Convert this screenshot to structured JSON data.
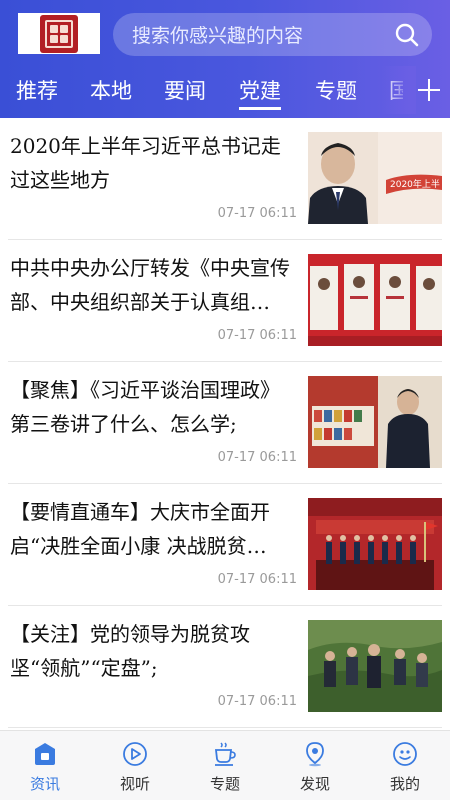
{
  "search": {
    "placeholder": "搜索你感兴趣的内容"
  },
  "tabs": [
    {
      "label": "推荐"
    },
    {
      "label": "本地"
    },
    {
      "label": "要闻"
    },
    {
      "label": "党建"
    },
    {
      "label": "专题"
    },
    {
      "label": "国"
    }
  ],
  "active_tab": "党建",
  "news": [
    {
      "title": "2020年上半年习近平总书记走过这些地方",
      "time": "07-17 06:11",
      "image_text": "2020年上半"
    },
    {
      "title": "中共中央办公厅转发《中央宣传部、中央组织部关于认真组…",
      "time": "07-17 06:11",
      "image_text": ""
    },
    {
      "title": "【聚焦】《习近平谈治国理政》第三卷讲了什么、怎么学;",
      "time": "07-17 06:11",
      "image_text": ""
    },
    {
      "title": "【要情直通车】大庆市全面开启“决胜全面小康 决战脱贫…",
      "time": "07-17 06:11",
      "image_text": ""
    },
    {
      "title": "【关注】党的领导为脱贫攻坚“领航”“定盘”;",
      "time": "07-17 06:11",
      "image_text": ""
    }
  ],
  "bottom_nav": [
    {
      "label": "资讯",
      "icon": "news-icon",
      "active": true
    },
    {
      "label": "视听",
      "icon": "play-icon",
      "active": false
    },
    {
      "label": "专题",
      "icon": "cup-icon",
      "active": false
    },
    {
      "label": "发现",
      "icon": "location-icon",
      "active": false
    },
    {
      "label": "我的",
      "icon": "profile-icon",
      "active": false
    }
  ],
  "colors": {
    "header_start": "#3a4fd6",
    "header_end": "#6a5fe4",
    "active_nav": "#3a7be0",
    "seal_red": "#b21f24"
  }
}
